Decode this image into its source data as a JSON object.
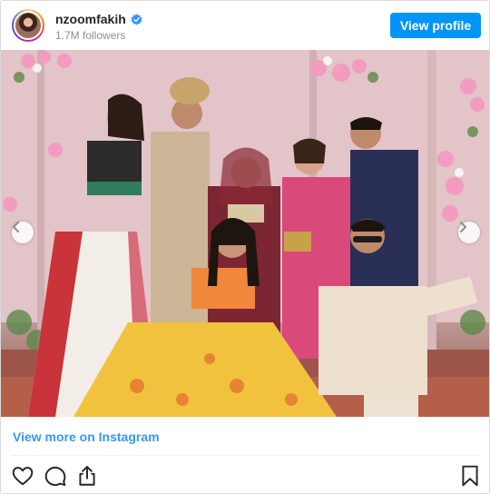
{
  "header": {
    "username": "nzoomfakih",
    "verified": true,
    "followers": "1.7M followers",
    "view_profile_label": "View profile"
  },
  "post": {
    "photo_icon": "wedding-group-photo",
    "carousel": {
      "prev_icon": "chevron-left-icon",
      "next_icon": "chevron-right-icon"
    }
  },
  "footer": {
    "view_more_label": "View more on Instagram",
    "actions": [
      "heart-icon",
      "comment-icon",
      "share-icon",
      "bookmark-icon"
    ]
  },
  "colors": {
    "accent": "#0095f6",
    "link": "#3897f0",
    "text": "#262626",
    "muted": "#8e8e8e",
    "verified": "#3897f0"
  }
}
